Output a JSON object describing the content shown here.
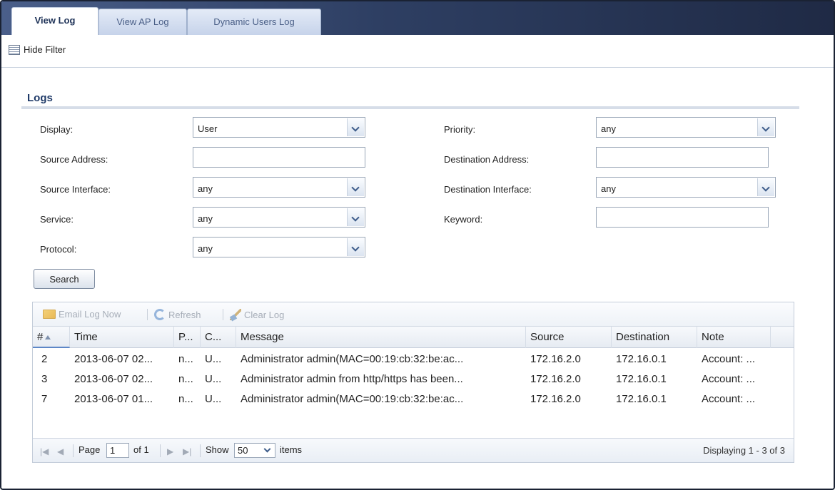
{
  "tabs": [
    {
      "label": "View Log",
      "active": true
    },
    {
      "label": "View AP Log",
      "active": false
    },
    {
      "label": "Dynamic Users Log",
      "active": false
    }
  ],
  "filterbar": {
    "hide_filter_label": "Hide Filter",
    "icon": "list-icon"
  },
  "section": {
    "title": "Logs"
  },
  "filters": {
    "display": {
      "label": "Display:",
      "value": "User"
    },
    "priority": {
      "label": "Priority:",
      "value": "any"
    },
    "source_address": {
      "label": "Source Address:",
      "value": ""
    },
    "destination_address": {
      "label": "Destination Address:",
      "value": ""
    },
    "source_interface": {
      "label": "Source Interface:",
      "value": "any"
    },
    "destination_interface": {
      "label": "Destination Interface:",
      "value": "any"
    },
    "service": {
      "label": "Service:",
      "value": "any"
    },
    "keyword": {
      "label": "Keyword:",
      "value": ""
    },
    "protocol": {
      "label": "Protocol:",
      "value": "any"
    }
  },
  "search_button": {
    "label": "Search"
  },
  "grid_toolbar": {
    "email": {
      "label": "Email Log Now",
      "icon": "envelope-icon"
    },
    "refresh": {
      "label": "Refresh",
      "icon": "refresh-icon"
    },
    "clear": {
      "label": "Clear Log",
      "icon": "broom-icon"
    }
  },
  "columns": [
    "#",
    "Time",
    "P...",
    "C...",
    "Message",
    "Source",
    "Destination",
    "Note"
  ],
  "rows": [
    {
      "num": "2",
      "time": "2013-06-07 02...",
      "p": "n...",
      "c": "U...",
      "message": "Administrator admin(MAC=00:19:cb:32:be:ac...",
      "source": "172.16.2.0",
      "destination": "172.16.0.1",
      "note": "Account: ..."
    },
    {
      "num": "3",
      "time": "2013-06-07 02...",
      "p": "n...",
      "c": "U...",
      "message": "Administrator admin from http/https has been...",
      "source": "172.16.2.0",
      "destination": "172.16.0.1",
      "note": "Account: ..."
    },
    {
      "num": "7",
      "time": "2013-06-07 01...",
      "p": "n...",
      "c": "U...",
      "message": "Administrator admin(MAC=00:19:cb:32:be:ac...",
      "source": "172.16.2.0",
      "destination": "172.16.0.1",
      "note": "Account: ..."
    }
  ],
  "pager": {
    "page_label": "Page",
    "page_value": "1",
    "of_label": "of 1",
    "show_label": "Show",
    "show_value": "50",
    "items_label": "items",
    "display_text": "Displaying 1 - 3 of 3"
  },
  "colors": {
    "accent": "#1f3a68",
    "tabbar_dark": "#1f2a45",
    "border": "#9aa7b8"
  }
}
